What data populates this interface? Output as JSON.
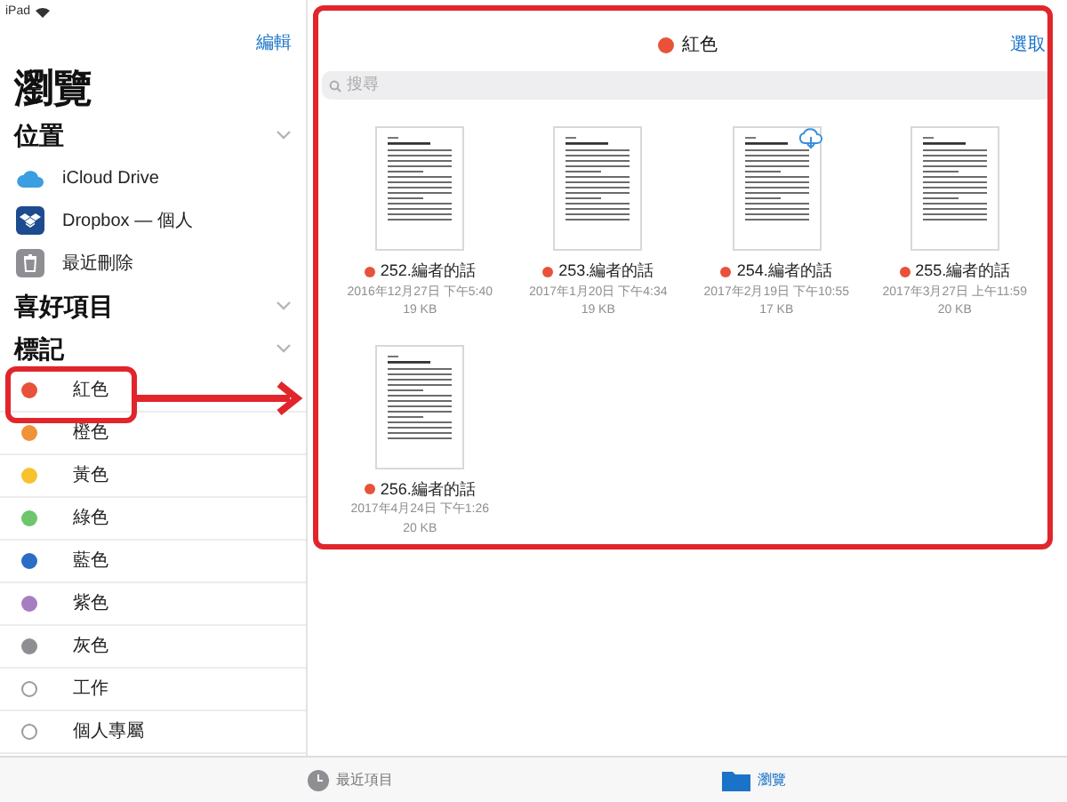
{
  "status_bar": {
    "device": "iPad"
  },
  "sidebar": {
    "edit_button": "編輯",
    "title": "瀏覽",
    "locations": {
      "title": "位置",
      "items": [
        {
          "label": "iCloud Drive",
          "kind": "icloud"
        },
        {
          "label": "Dropbox — 個人",
          "kind": "dropbox"
        },
        {
          "label": "最近刪除",
          "kind": "trash"
        }
      ]
    },
    "favorites": {
      "title": "喜好項目"
    },
    "tags": {
      "title": "標記",
      "items": [
        {
          "label": "紅色",
          "kind": "dot",
          "color": "#e8523a"
        },
        {
          "label": "橙色",
          "kind": "dot",
          "color": "#f0923a"
        },
        {
          "label": "黃色",
          "kind": "dot",
          "color": "#f7c22e"
        },
        {
          "label": "綠色",
          "kind": "dot",
          "color": "#6cc66b"
        },
        {
          "label": "藍色",
          "kind": "dot",
          "color": "#2b6cc4"
        },
        {
          "label": "紫色",
          "kind": "dot",
          "color": "#a77dc2"
        },
        {
          "label": "灰色",
          "kind": "dot",
          "color": "#8e8e93"
        },
        {
          "label": "工作",
          "kind": "outline"
        },
        {
          "label": "個人專屬",
          "kind": "outline"
        }
      ]
    }
  },
  "content": {
    "tag": {
      "label": "紅色",
      "color": "#e8523a"
    },
    "select_button": "選取",
    "search": {
      "placeholder": "搜尋"
    },
    "files": [
      {
        "name": "252.編者的話",
        "date": "2016年12月27日 下午5:40",
        "size": "19 KB",
        "color": "#e8523a",
        "in_cloud": false
      },
      {
        "name": "253.編者的話",
        "date": "2017年1月20日 下午4:34",
        "size": "19 KB",
        "color": "#e8523a",
        "in_cloud": false
      },
      {
        "name": "254.編者的話",
        "date": "2017年2月19日 下午10:55",
        "size": "17 KB",
        "color": "#e8523a",
        "in_cloud": true
      },
      {
        "name": "255.編者的話",
        "date": "2017年3月27日 上午11:59",
        "size": "20 KB",
        "color": "#e8523a",
        "in_cloud": false
      },
      {
        "name": "256.編者的話",
        "date": "2017年4月24日 下午1:26",
        "size": "20 KB",
        "color": "#e8523a",
        "in_cloud": false
      }
    ]
  },
  "tab_bar": [
    {
      "label": "最近項目",
      "kind": "clock",
      "selected": false
    },
    {
      "label": "瀏覽",
      "kind": "folder",
      "selected": true
    }
  ]
}
